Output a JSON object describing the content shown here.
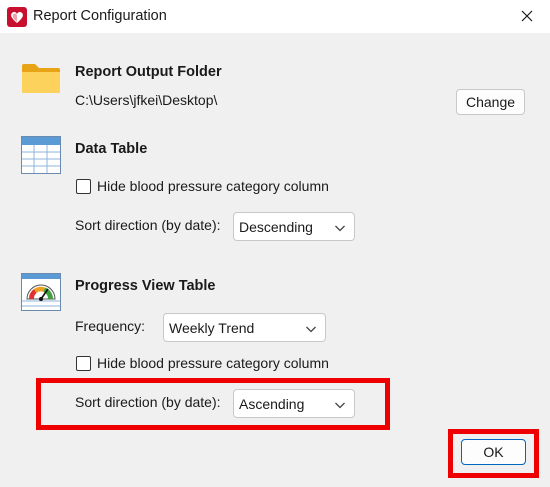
{
  "window": {
    "title": "Report Configuration",
    "icon": "heart-app-icon",
    "close_icon": "close-icon"
  },
  "output_folder": {
    "heading": "Report Output Folder",
    "path": "C:\\Users\\jfkei\\Desktop\\",
    "change_label": "Change",
    "icon": "folder-icon"
  },
  "data_table": {
    "heading": "Data Table",
    "icon": "table-icon",
    "hide_category_label": "Hide blood pressure category column",
    "hide_category_checked": false,
    "sort_label": "Sort direction (by date):",
    "sort_value": "Descending"
  },
  "progress_table": {
    "heading": "Progress View Table",
    "icon": "gauge-table-icon",
    "frequency_label": "Frequency:",
    "frequency_value": "Weekly Trend",
    "hide_category_label": "Hide blood pressure category column",
    "hide_category_checked": false,
    "sort_label": "Sort direction (by date):",
    "sort_value": "Ascending"
  },
  "footer": {
    "ok_label": "OK"
  },
  "colors": {
    "highlight": "#ee0000",
    "accent": "#0067c0"
  }
}
